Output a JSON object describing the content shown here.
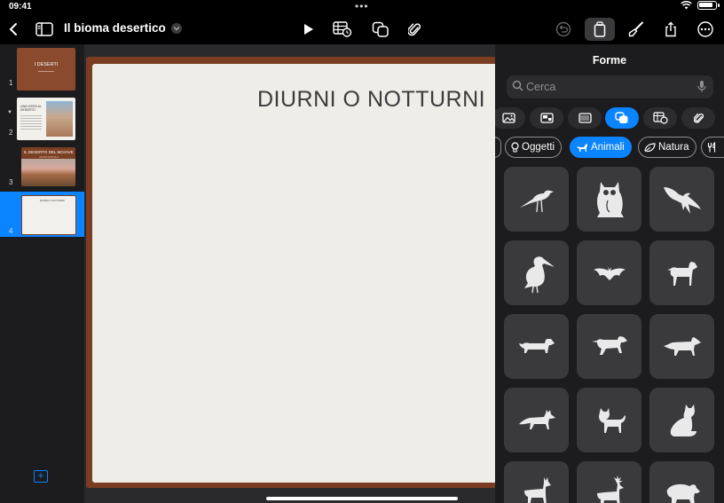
{
  "status": {
    "time": "09:41",
    "dots": "•••"
  },
  "toolbar": {
    "title": "Il bioma desertico",
    "icons": [
      "chevron-left-icon",
      "sidebar-icon",
      "chevron-down-icon",
      "play-icon",
      "table-icon",
      "shapes-icon",
      "paperclip-icon",
      "undo-icon",
      "format-icon",
      "paintbrush-icon",
      "share-icon",
      "more-icon"
    ]
  },
  "navigator": {
    "slides": [
      {
        "number": "1",
        "title": "I DESERTI"
      },
      {
        "number": "2",
        "title": "UNA VISITA AL DESERTO"
      },
      {
        "number": "3",
        "title": "IL DESERTO DEL MOJAVE",
        "subtitle": "UN SOTTOTITOLO"
      },
      {
        "number": "4",
        "title": "DIURNI O NOTTURNI",
        "selected": true
      }
    ]
  },
  "slide": {
    "title": "DIURNI O NOTTURNI"
  },
  "panel": {
    "title": "Forme",
    "search_placeholder": "Cerca",
    "category_tabs": [
      "image-icon",
      "photo-collage-icon",
      "texture-icon",
      "shapes-icon",
      "table-icon",
      "paperclip-icon"
    ],
    "chips": [
      {
        "label": "Oggetti",
        "icon": "lightbulb-icon"
      },
      {
        "label": "Animali",
        "icon": "animal-icon",
        "active": true
      },
      {
        "label": "Natura",
        "icon": "leaf-icon"
      },
      {
        "label": "",
        "icon": "fork-knife-icon"
      }
    ],
    "shapes": [
      "bird-icon",
      "owl-icon",
      "eagle-icon",
      "pelican-icon",
      "bat-icon",
      "dog-icon",
      "dachshund-icon",
      "dog-running-icon",
      "wolf-icon",
      "fox-icon",
      "cat-icon",
      "cat-sitting-icon",
      "deer-icon",
      "stag-icon",
      "bear-icon"
    ]
  },
  "colors": {
    "accent": "#0a84ff",
    "slide_frame": "#7a3d22",
    "panel_bg": "#1c1c1e",
    "tile_bg": "#3a3a3c"
  }
}
